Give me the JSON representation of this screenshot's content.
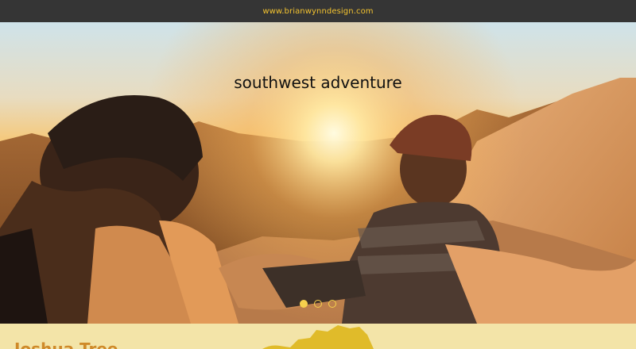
{
  "header": {
    "site_link": "www.brianwynndesign.com"
  },
  "hero": {
    "title": "southwest adventure",
    "slides": [
      {
        "active": true
      },
      {
        "active": false
      },
      {
        "active": false
      }
    ]
  },
  "section": {
    "heading": "Joshua Tree"
  },
  "colors": {
    "topbar": "#353535",
    "accent": "#f2c230",
    "section_bg": "#f3e4a8",
    "heading": "#cf8a2a"
  }
}
